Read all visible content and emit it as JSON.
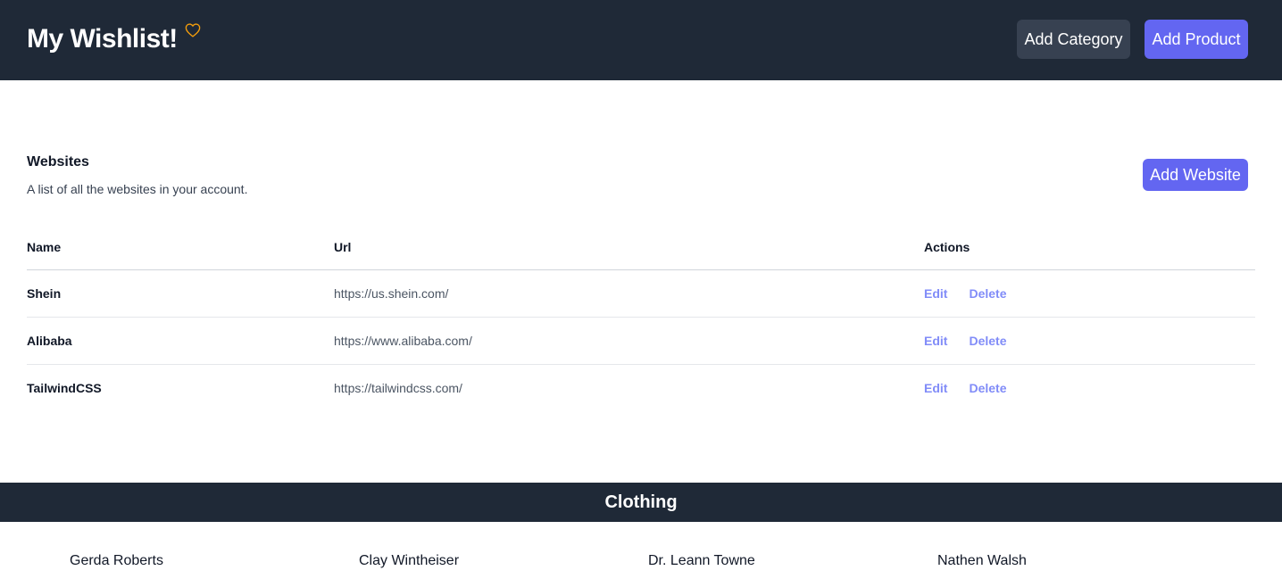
{
  "header": {
    "title": "My Wishlist!",
    "heart_icon": "heart-icon",
    "heart_color": "#f59e0b",
    "buttons": {
      "add_category": "Add Category",
      "add_product": "Add Product"
    }
  },
  "websites": {
    "title": "Websites",
    "description": "A list of all the websites in your account.",
    "add_button": "Add Website",
    "columns": [
      "Name",
      "Url",
      "Actions"
    ],
    "rows": [
      {
        "name": "Shein",
        "url": "https://us.shein.com/",
        "edit": "Edit",
        "delete": "Delete"
      },
      {
        "name": "Alibaba",
        "url": "https://www.alibaba.com/",
        "edit": "Edit",
        "delete": "Delete"
      },
      {
        "name": "TailwindCSS",
        "url": "https://tailwindcss.com/",
        "edit": "Edit",
        "delete": "Delete"
      }
    ]
  },
  "category": {
    "title": "Clothing",
    "products": [
      "Gerda Roberts",
      "Clay Wintheiser",
      "Dr. Leann Towne",
      "Nathen Walsh"
    ]
  },
  "colors": {
    "header_bg": "#1f2937",
    "accent": "#6366f1",
    "secondary_button": "#374151",
    "action_link": "#818cf8"
  }
}
